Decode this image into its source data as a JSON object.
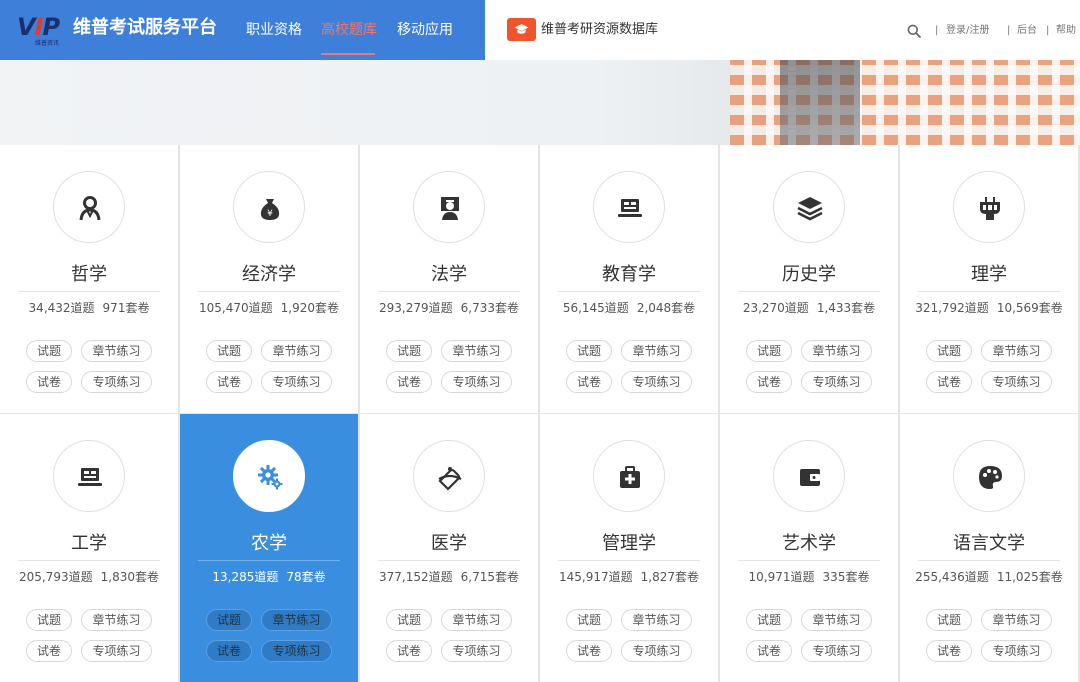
{
  "header": {
    "logo_text": "VIP",
    "logo_sub": "维普资讯",
    "brand": "维普考试服务平台",
    "nav": [
      {
        "label": "职业资格",
        "active": false
      },
      {
        "label": "高校题库",
        "active": true
      },
      {
        "label": "移动应用",
        "active": false
      }
    ],
    "db_icon": "graduation-cap-icon",
    "db_label": "维普考研资源数据库",
    "login": "登录/注册",
    "admin": "后台",
    "help": "帮助",
    "sep": "|"
  },
  "categories": [
    {
      "name": "哲学",
      "icon": "person-icon",
      "questions": "34,432道题",
      "papers": "971套卷"
    },
    {
      "name": "经济学",
      "icon": "money-bag-icon",
      "questions": "105,470道题",
      "papers": "1,920套卷"
    },
    {
      "name": "法学",
      "icon": "judge-icon",
      "questions": "293,279道题",
      "papers": "6,733套卷"
    },
    {
      "name": "教育学",
      "icon": "laptop-icon",
      "questions": "56,145道题",
      "papers": "2,048套卷"
    },
    {
      "name": "历史学",
      "icon": "layers-icon",
      "questions": "23,270道题",
      "papers": "1,433套卷"
    },
    {
      "name": "理学",
      "icon": "flask-icon",
      "questions": "321,792道题",
      "papers": "10,569套卷"
    },
    {
      "name": "工学",
      "icon": "laptop-icon",
      "questions": "205,793道题",
      "papers": "1,830套卷"
    },
    {
      "name": "农学",
      "icon": "gear-icon",
      "questions": "13,285道题",
      "papers": "78套卷",
      "active": true
    },
    {
      "name": "医学",
      "icon": "pills-icon",
      "questions": "377,152道题",
      "papers": "6,715套卷"
    },
    {
      "name": "管理学",
      "icon": "medical-kit-icon",
      "questions": "145,917道题",
      "papers": "1,827套卷"
    },
    {
      "name": "艺术学",
      "icon": "wallet-icon",
      "questions": "10,971道题",
      "papers": "335套卷"
    },
    {
      "name": "语言文学",
      "icon": "palette-icon",
      "questions": "255,436道题",
      "papers": "11,025套卷"
    }
  ],
  "buttons": {
    "questions": "试题",
    "chapter": "章节练习",
    "papers": "试卷",
    "special": "专项练习"
  },
  "colors": {
    "header_blue": "#3d7fd9",
    "active_card": "#3a8ee0",
    "accent_red": "#f0786a",
    "db_orange": "#f0542d"
  }
}
